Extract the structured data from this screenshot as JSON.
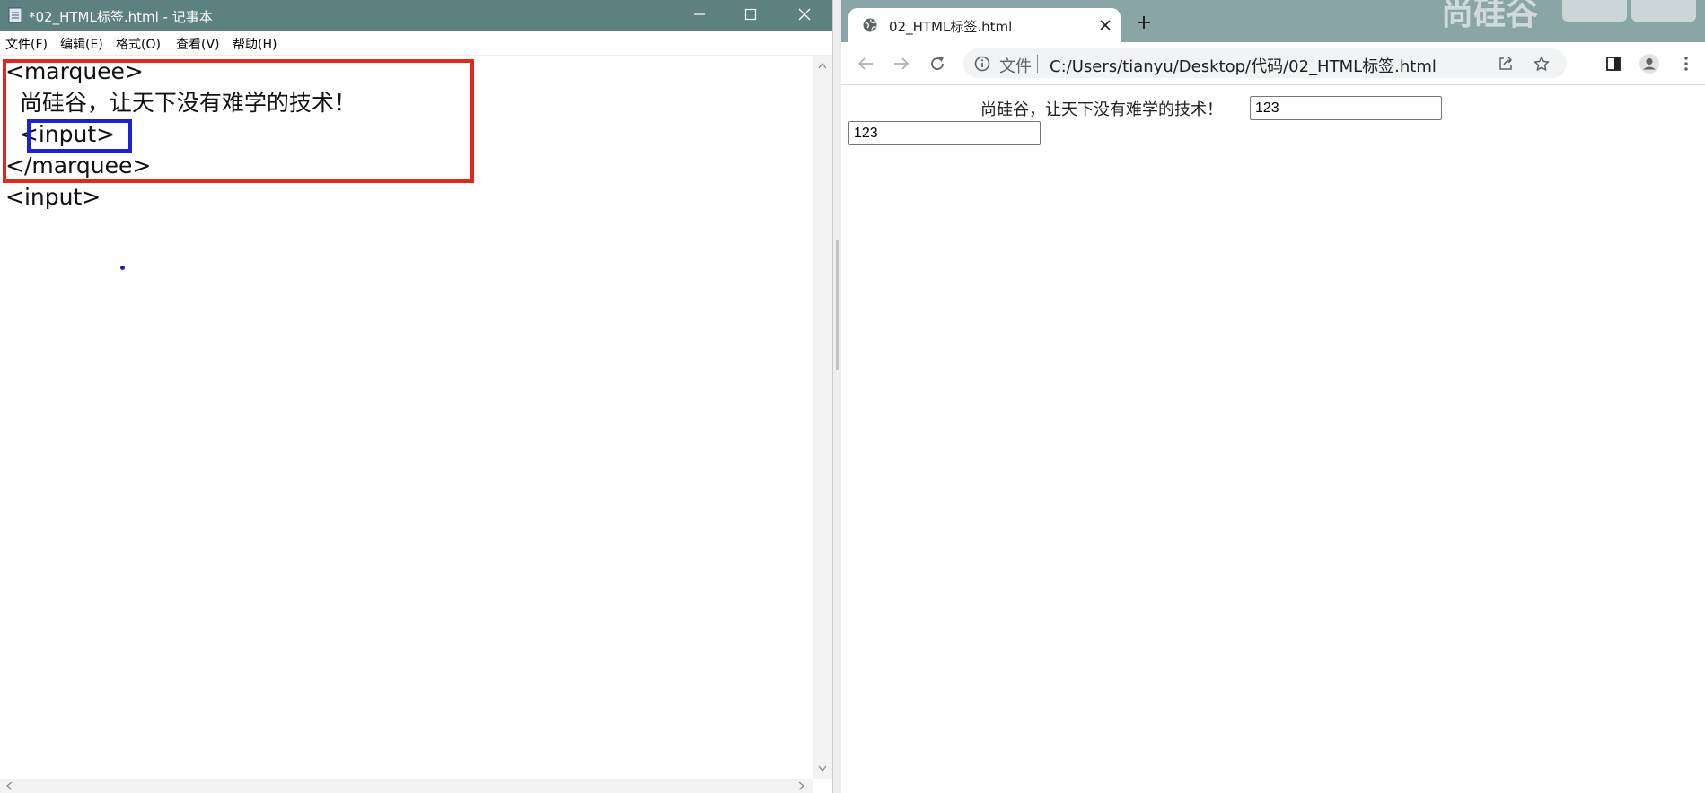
{
  "notepad": {
    "title": "*02_HTML标签.html - 记事本",
    "window_controls": [
      "minimize",
      "maximize",
      "close"
    ],
    "menu": [
      "文件(F)",
      "编辑(E)",
      "格式(O)",
      "查看(V)",
      "帮助(H)"
    ],
    "lines": [
      "<marquee>",
      "  尚硅谷，让天下没有难学的技术！",
      "  <input>",
      "</marquee>",
      "<input>"
    ],
    "highlights": [
      {
        "color": "#e0281d",
        "target": "marquee block"
      },
      {
        "color": "#1a22d6",
        "target": "<input>"
      }
    ]
  },
  "browser": {
    "tab": {
      "title": "02_HTML标签.html"
    },
    "address": {
      "scheme_label": "文件",
      "url": "C:/Users/tianyu/Desktop/代码/02_HTML标签.html"
    },
    "watermark": "尚硅谷",
    "page": {
      "text": "尚硅谷，让天下没有难学的技术！",
      "inputs": [
        "123",
        "123"
      ]
    }
  },
  "colors": {
    "notepad_titlebar": "#5c8180",
    "browser_tabstrip": "#89a5a6",
    "highlight_red": "#e0281d",
    "highlight_blue": "#1a22d6"
  }
}
